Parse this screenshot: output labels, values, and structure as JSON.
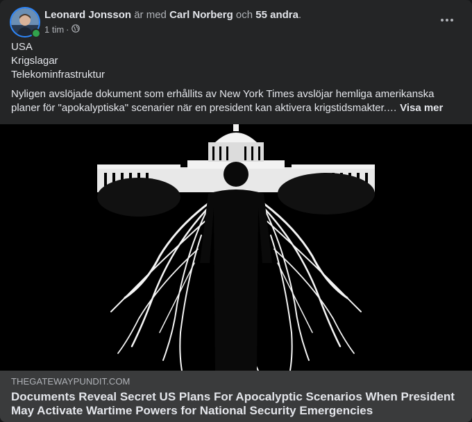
{
  "post": {
    "author": "Leonard Jonsson",
    "with_text": "är med",
    "tagged_person": "Carl Norberg",
    "and_text": "och",
    "others": "55 andra",
    "punct": ".",
    "time": "1 tim",
    "dot": "·",
    "privacy_icon": "globe-icon",
    "more_icon": "more-options-icon"
  },
  "body": {
    "tags": [
      "USA",
      "Krigslagar",
      "Telekominfrastruktur"
    ],
    "paragraph": "Nyligen avslöjade dokument som erhållits av New York Times avslöjar hemliga amerikanska planer för \"apokalyptiska\" scenarier när en president kan aktivera krigstidsmakter.…",
    "see_more": "Visa mer"
  },
  "link_preview": {
    "domain": "THEGATEWAYPUNDIT.COM",
    "headline": "Documents Reveal Secret US Plans For Apocalyptic Scenarios When President May Activate Wartime Powers for National Security Emergencies"
  },
  "colors": {
    "card_bg": "#242526",
    "link_bg": "#3a3b3c",
    "online": "#31a24c"
  }
}
